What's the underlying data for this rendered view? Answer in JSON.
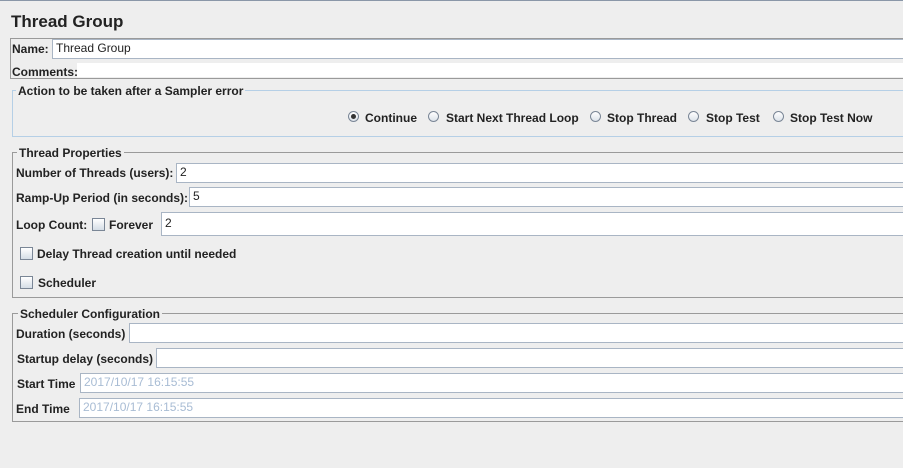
{
  "title": "Thread Group",
  "name": {
    "label": "Name:",
    "value": "Thread Group"
  },
  "comments": {
    "label": "Comments:",
    "value": ""
  },
  "sampler_error": {
    "legend": "Action to be taken after a Sampler error",
    "options": [
      "Continue",
      "Start Next Thread Loop",
      "Stop Thread",
      "Stop Test",
      "Stop Test Now"
    ],
    "selected": "Continue"
  },
  "thread_props": {
    "legend": "Thread Properties",
    "threads_label": "Number of Threads (users):",
    "threads": "2",
    "rampup_label": "Ramp-Up Period (in seconds):",
    "rampup": "5",
    "loop_label": "Loop Count:",
    "forever_label": "Forever",
    "forever": false,
    "loop": "2",
    "delay_label": "Delay Thread creation until needed",
    "delay": false,
    "scheduler_label": "Scheduler",
    "scheduler": false
  },
  "scheduler_config": {
    "legend": "Scheduler Configuration",
    "duration_label": "Duration (seconds)",
    "duration": "",
    "startup_label": "Startup delay (seconds)",
    "startup": "",
    "start_label": "Start Time",
    "start": "2017/10/17 16:15:55",
    "end_label": "End Time",
    "end": "2017/10/17 16:15:55"
  }
}
